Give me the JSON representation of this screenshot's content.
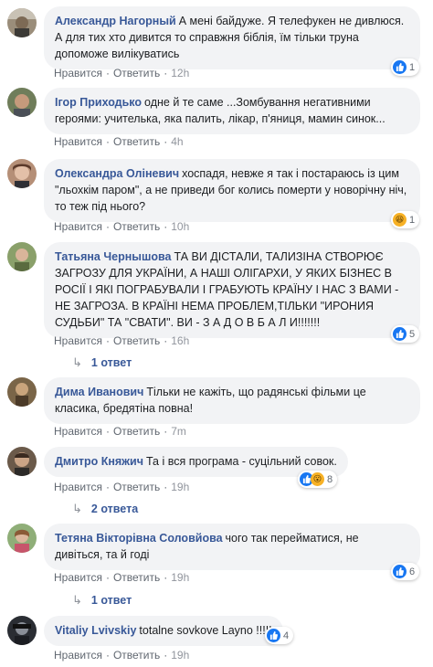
{
  "labels": {
    "like": "Нравится",
    "reply": "Ответить",
    "sep": "·"
  },
  "colors": {
    "author": "#385898",
    "bubble": "#f2f3f5",
    "like": "#1877f2"
  },
  "comments": [
    {
      "author": "Александр Нагорный",
      "text": "А мені байдуже. Я телефукен не дивлюся. А для тих хто дивится то справжня біблія, їм тільки труна допоможе вилікуватись",
      "time": "12h",
      "reactions": {
        "icons": [
          "like-icon"
        ],
        "count": "1"
      }
    },
    {
      "author": "Ігор Приходько",
      "text": "одне й те саме ...Зомбування негативними героями: учителька, яка палить, лікар, п'яниця, мамин синок...",
      "time": "4h"
    },
    {
      "author": "Олександра Оліневич",
      "text": "хоспадя, невже я так і постараюсь із цим \"льохкім паром\", а не приведи бог колись померти у новорічну ніч, то теж під нього?",
      "time": "10h",
      "reactions": {
        "icons": [
          "haha-icon"
        ],
        "count": "1"
      }
    },
    {
      "author": "Татьяна Чернышова",
      "text": "ТА ВИ ДІСТАЛИ, ТАЛИЗІНА СТВОРЮЄ ЗАГРОЗУ ДЛЯ УКРАЇНИ, А НАШІ ОЛІГАРХИ, У ЯКИХ БІЗНЕС В РОСІЇ І ЯКІ ПОГРАБУВАЛИ І ГРАБУЮТЬ КРАЇНУ І НАС З ВАМИ - НЕ ЗАГРОЗА. В КРАЇНІ НЕМА ПРОБЛЕМ,ТІЛЬКИ \"ИРОНИЯ СУДЬБИ\" ТА \"СВАТИ\". ВИ - З А Д О В Б А Л И!!!!!!!",
      "time": "16h",
      "reactions": {
        "icons": [
          "like-icon"
        ],
        "count": "5"
      },
      "replies": "1 ответ"
    },
    {
      "author": "Дима Иванович",
      "text": "Тільки не кажіть, що радянські фільми це класика, бредятіна повна!",
      "time": "7m"
    },
    {
      "author": "Дмитро Княжич",
      "text": "Та і вся програма - суцільний совок.",
      "time": "19h",
      "reactions": {
        "icons": [
          "like-icon",
          "wow-icon"
        ],
        "count": "8"
      },
      "replies": "2 ответа"
    },
    {
      "author": "Тетяна Вікторівна Соловйова",
      "text": "чого так перейматися, не дивіться, та й годі",
      "time": "19h",
      "reactions": {
        "icons": [
          "like-icon"
        ],
        "count": "6"
      },
      "replies": "1 ответ"
    },
    {
      "author": "Vitaliy Lvivskiy",
      "text": "totalne sovkove Layno !!!!!",
      "time": "19h",
      "reactions": {
        "icons": [
          "like-icon"
        ],
        "count": "4"
      }
    }
  ]
}
